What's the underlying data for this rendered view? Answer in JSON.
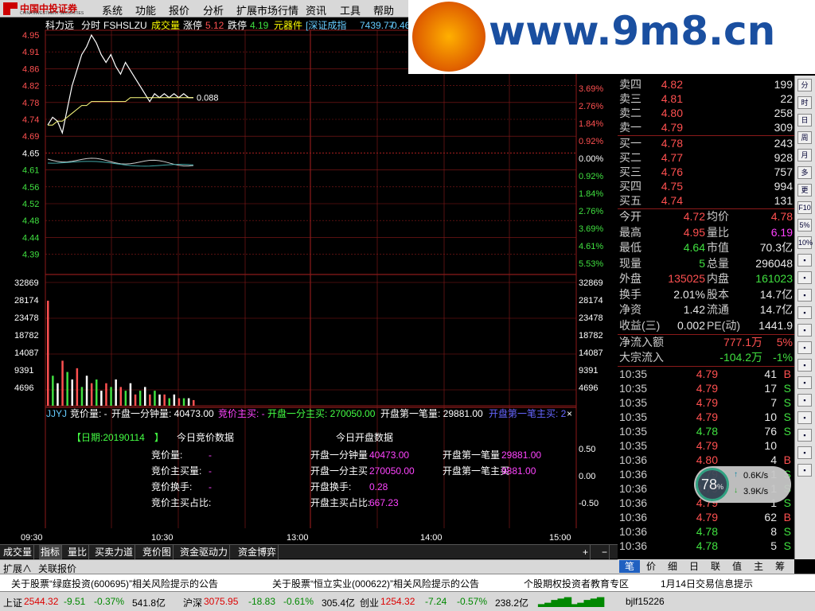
{
  "menu": {
    "brand": "中国中投证券",
    "brand_sub": "CHINA INVESTMENT SECURITIES",
    "items": [
      "系统",
      "功能",
      "报价",
      "分析",
      "扩展市场行情",
      "资讯",
      "工具",
      "帮助"
    ]
  },
  "header": {
    "stock": "科力远",
    "mode": "分时",
    "code": "FSHSLZU",
    "vol_label": "成交量",
    "up_label": "涨停",
    "up_val": "5.12",
    "down_label": "跌停",
    "down_val": "4.19",
    "sector": "元器件",
    "index_label": "[深证成指",
    "index_val": "7439.77",
    "index_chg": "-0.46"
  },
  "colors": {
    "up": "#ff5050",
    "down": "#40e040",
    "grid": "#8b1a1a",
    "price_line": "#ffffff",
    "avg_line": "#ffff80"
  },
  "chart_data": {
    "type": "line",
    "price_axis": [
      "4.95",
      "4.91",
      "4.86",
      "4.82",
      "4.78",
      "4.74",
      "4.69",
      "4.65",
      "4.61",
      "4.56",
      "4.52",
      "4.48",
      "4.44",
      "4.39"
    ],
    "pct_axis": [
      "3.69%",
      "2.76%",
      "1.84%",
      "0.92%",
      "0.00%",
      "0.92%",
      "1.84%",
      "2.76%",
      "3.69%",
      "4.61%",
      "5.53%"
    ],
    "vol_axis": [
      "32869",
      "28174",
      "23478",
      "18782",
      "14087",
      "9391",
      "4696"
    ],
    "time_axis": [
      "09:30",
      "10:30",
      "13:00",
      "14:00",
      "15:00"
    ],
    "ylim": [
      4.39,
      4.95
    ],
    "price": [
      4.72,
      4.74,
      4.73,
      4.7,
      4.76,
      4.82,
      4.86,
      4.9,
      4.92,
      4.95,
      4.93,
      4.9,
      4.88,
      4.9,
      4.87,
      4.85,
      4.88,
      4.86,
      4.84,
      4.82,
      4.8,
      4.78,
      4.8,
      4.79,
      4.8,
      4.79,
      4.8,
      4.79,
      4.8,
      4.79,
      4.79
    ],
    "avg": [
      4.72,
      4.72,
      4.73,
      4.73,
      4.74,
      4.75,
      4.76,
      4.77,
      4.77,
      4.78,
      4.78,
      4.78,
      4.78,
      4.78,
      4.78,
      4.78,
      4.78,
      4.79,
      4.79,
      4.79,
      4.79,
      4.79,
      4.79,
      4.79,
      4.79,
      4.79,
      4.79,
      4.79,
      4.79,
      4.79,
      4.79
    ],
    "price_label": "0.088",
    "volume": [
      28000,
      8000,
      6000,
      12000,
      9000,
      7000,
      10000,
      5000,
      8000,
      6000,
      7000,
      4000,
      6000,
      5000,
      7000,
      5000,
      4000,
      6000,
      3000,
      4000,
      5000,
      3000,
      4000,
      3000,
      3000,
      2000,
      3000,
      2000,
      2000,
      2000,
      1500
    ],
    "bottom_left": "JJYJ",
    "bottom_labels": [
      "竞价量: -",
      "开盘一分钟量: 40473.00",
      "竞价主买: -",
      "开盘一分主买: 270050.00",
      "开盘第一笔量: 29881.00",
      "开盘第一笔主买: 2"
    ],
    "auction_axis": [
      "0.50",
      "0.00",
      "-0.50"
    ]
  },
  "auction": {
    "date": "【日期:20190114　】",
    "today_bid": "今日竞价数据",
    "today_open": "今日开盘数据",
    "rows": [
      {
        "a": "竞价量:",
        "av": "-",
        "b": "开盘一分钟量",
        "bv": "40473.00",
        "c": "开盘第一笔量",
        "cv": "29881.00"
      },
      {
        "a": "竞价主买量:",
        "av": "-",
        "b": "开盘一分主买",
        "bv": "270050.00",
        "c": "开盘第一笔主买",
        "cv": "9881.00"
      },
      {
        "a": "竞价换手:",
        "av": "-",
        "b": "开盘换手:",
        "bv": "0.28",
        "c": "",
        "cv": ""
      },
      {
        "a": "竞价主买占比:",
        "av": "",
        "b": "开盘主买占比:",
        "bv": "667.23",
        "c": "",
        "cv": ""
      }
    ]
  },
  "orderbook": {
    "asks": [
      {
        "l": "卖四",
        "p": "4.82",
        "v": "199"
      },
      {
        "l": "卖三",
        "p": "4.81",
        "v": "22"
      },
      {
        "l": "卖二",
        "p": "4.80",
        "v": "258"
      },
      {
        "l": "卖一",
        "p": "4.79",
        "v": "309"
      }
    ],
    "bids": [
      {
        "l": "买一",
        "p": "4.78",
        "v": "243"
      },
      {
        "l": "买二",
        "p": "4.77",
        "v": "928"
      },
      {
        "l": "买三",
        "p": "4.76",
        "v": "757"
      },
      {
        "l": "买四",
        "p": "4.75",
        "v": "994"
      },
      {
        "l": "买五",
        "p": "4.74",
        "v": "131"
      }
    ]
  },
  "stats": [
    {
      "l1": "今开",
      "v1": "4.72",
      "c1": "red",
      "l2": "均价",
      "v2": "4.78",
      "c2": "red"
    },
    {
      "l1": "最高",
      "v1": "4.95",
      "c1": "red",
      "l2": "量比",
      "v2": "6.19",
      "c2": "mag"
    },
    {
      "l1": "最低",
      "v1": "4.64",
      "c1": "green",
      "l2": "市值",
      "v2": "70.3亿",
      "c2": "white"
    },
    {
      "l1": "现量",
      "v1": "5",
      "c1": "green",
      "l2": "总量",
      "v2": "296048",
      "c2": "white"
    },
    {
      "l1": "外盘",
      "v1": "135025",
      "c1": "red",
      "l2": "内盘",
      "v2": "161023",
      "c2": "green"
    },
    {
      "l1": "换手",
      "v1": "2.01%",
      "c1": "white",
      "l2": "股本",
      "v2": "14.7亿",
      "c2": "white"
    },
    {
      "l1": "净资",
      "v1": "1.42",
      "c1": "white",
      "l2": "流通",
      "v2": "14.7亿",
      "c2": "white"
    },
    {
      "l1": "收益(三)",
      "v1": "0.002",
      "c1": "white",
      "l2": "PE(动)",
      "v2": "1441.9",
      "c2": "white"
    }
  ],
  "flow": [
    {
      "l": "净流入额",
      "v": "777.1万",
      "c": "red",
      "p": "5%"
    },
    {
      "l": "大宗流入",
      "v": "-104.2万",
      "c": "green",
      "p": "-1%"
    }
  ],
  "ticks": [
    {
      "t": "10:35",
      "p": "4.79",
      "v": "41",
      "s": "B"
    },
    {
      "t": "10:35",
      "p": "4.79",
      "v": "17",
      "s": "S"
    },
    {
      "t": "10:35",
      "p": "4.79",
      "v": "7",
      "s": "S"
    },
    {
      "t": "10:35",
      "p": "4.79",
      "v": "10",
      "s": "S"
    },
    {
      "t": "10:35",
      "p": "4.78",
      "v": "76",
      "s": "S"
    },
    {
      "t": "10:35",
      "p": "4.79",
      "v": "10",
      "s": ""
    },
    {
      "t": "10:36",
      "p": "4.80",
      "v": "4",
      "s": "B"
    },
    {
      "t": "10:36",
      "p": "4.79",
      "v": "1",
      "s": "S"
    },
    {
      "t": "10:36",
      "p": "4.79",
      "v": "1",
      "s": "S"
    },
    {
      "t": "10:36",
      "p": "4.79",
      "v": "1",
      "s": "S"
    },
    {
      "t": "10:36",
      "p": "4.79",
      "v": "62",
      "s": "B"
    },
    {
      "t": "10:36",
      "p": "4.78",
      "v": "8",
      "s": "S"
    },
    {
      "t": "10:36",
      "p": "4.78",
      "v": "5",
      "s": "S"
    }
  ],
  "tabs": [
    "成交量",
    "指标",
    "量比",
    "买卖力道",
    "竞价图",
    "资金驱动力",
    "资金博弈"
  ],
  "expand": [
    "扩展∧",
    "关联报价"
  ],
  "btabs": [
    "笔",
    "价",
    "细",
    "日",
    "联",
    "值",
    "主",
    "筹"
  ],
  "news": [
    "关于股票“绿庭投资(600695)”相关风险提示的公告",
    "关于股票“恒立实业(000622)”相关风险提示的公告",
    "个股期权投资者教育专区",
    "1月14日交易信息提示"
  ],
  "status": {
    "sh": "上证",
    "sh_val": "2544.32",
    "sh_chg": "-9.51",
    "sh_pct": "-0.37%",
    "sh_amt": "541.8亿",
    "sz": "沪深",
    "sz_val": "3075.95",
    "sz_chg": "-18.83",
    "sz_pct": "-0.61%",
    "sz_amt": "305.4亿",
    "cy": "创业",
    "cy_val": "1254.32",
    "cy_chg": "-7.24",
    "cy_pct": "-0.57%",
    "cy_amt": "238.2亿",
    "server": "bjlf15226"
  },
  "sidebar": [
    "分",
    "时",
    "日",
    "周",
    "月",
    "多",
    "更",
    "F10",
    "5%",
    "10%"
  ],
  "speed": {
    "pct": "78",
    "unit": "%",
    "up": "0.6K/s",
    "down": "3.9K/s"
  },
  "watermark": "www.9m8.cn"
}
